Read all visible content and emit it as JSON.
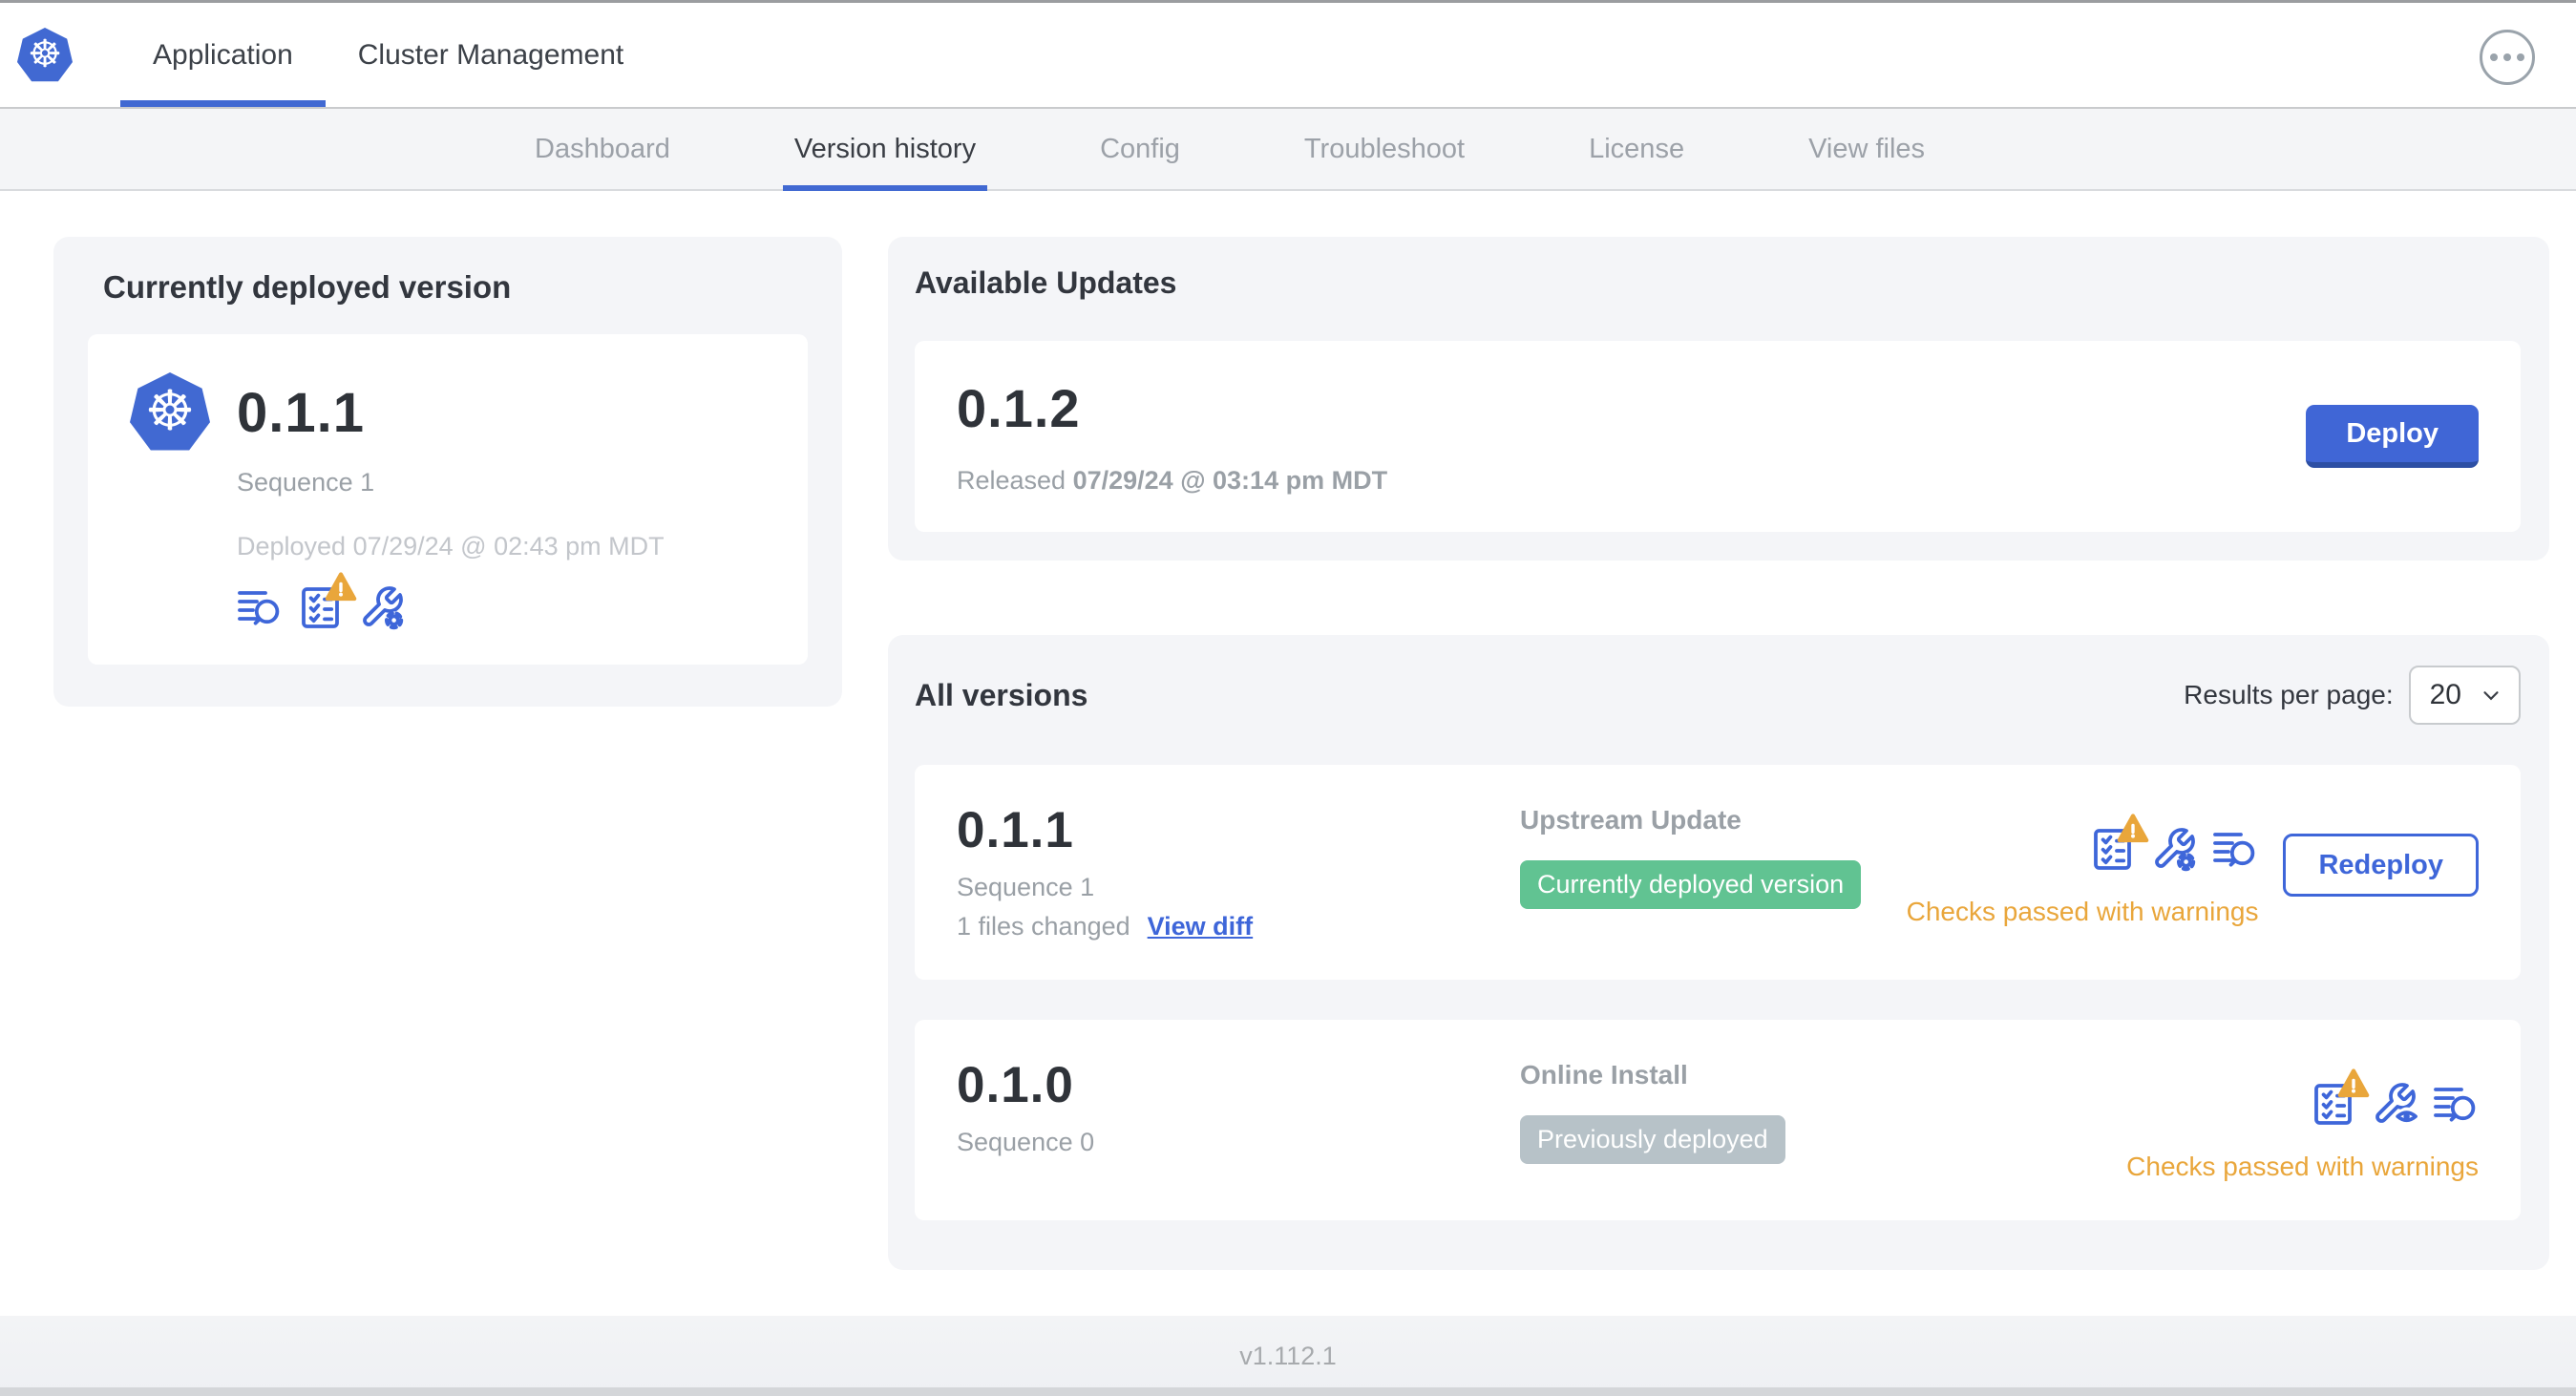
{
  "header": {
    "logo": "kubernetes-logo",
    "tabs": [
      {
        "label": "Application",
        "active": true
      },
      {
        "label": "Cluster Management",
        "active": false
      }
    ],
    "menu_icon": "ellipsis-icon"
  },
  "subnav": {
    "tabs": [
      {
        "label": "Dashboard",
        "active": false
      },
      {
        "label": "Version history",
        "active": true
      },
      {
        "label": "Config",
        "active": false
      },
      {
        "label": "Troubleshoot",
        "active": false
      },
      {
        "label": "License",
        "active": false
      },
      {
        "label": "View files",
        "active": false
      }
    ]
  },
  "deployed_card": {
    "title": "Currently deployed version",
    "version": "0.1.1",
    "sequence": "Sequence 1",
    "deployed_at": "Deployed 07/29/24 @ 02:43 pm MDT",
    "icons": [
      "diff-icon",
      "preflight-checks-warning-icon",
      "config-gear-icon"
    ]
  },
  "updates_card": {
    "title": "Available Updates",
    "version": "0.1.2",
    "released_label": "Released",
    "released_at": "07/29/24 @ 03:14 pm MDT",
    "deploy_label": "Deploy"
  },
  "all_versions": {
    "title": "All versions",
    "results_per_page_label": "Results per page:",
    "results_per_page_value": "20",
    "rows": [
      {
        "version": "0.1.1",
        "sequence": "Sequence 1",
        "files_changed": "1 files changed",
        "view_diff_label": "View diff",
        "source": "Upstream Update",
        "badge": "Currently deployed version",
        "badge_color": "green",
        "icons": [
          "preflight-checks-warning-icon",
          "config-gear-icon",
          "diff-icon"
        ],
        "status": "Checks passed with warnings",
        "action_label": "Redeploy"
      },
      {
        "version": "0.1.0",
        "sequence": "Sequence 0",
        "source": "Online Install",
        "badge": "Previously deployed",
        "badge_color": "gray",
        "icons": [
          "preflight-checks-warning-icon",
          "config-eye-icon",
          "diff-icon"
        ],
        "status": "Checks passed with warnings"
      }
    ]
  },
  "footer": {
    "version": "v1.112.1"
  },
  "colors": {
    "accent_blue": "#3e66d9",
    "button_blue": "#4066d6",
    "logo_blue": "#4169d2",
    "badge_green": "#61c392",
    "badge_gray": "#b7c2c8",
    "warning_amber": "#e9a63b",
    "card_gray": "#f4f5f8",
    "text_dark": "#32363e",
    "text_gray": "#9aa0a6",
    "text_light": "#c3c6cb"
  }
}
